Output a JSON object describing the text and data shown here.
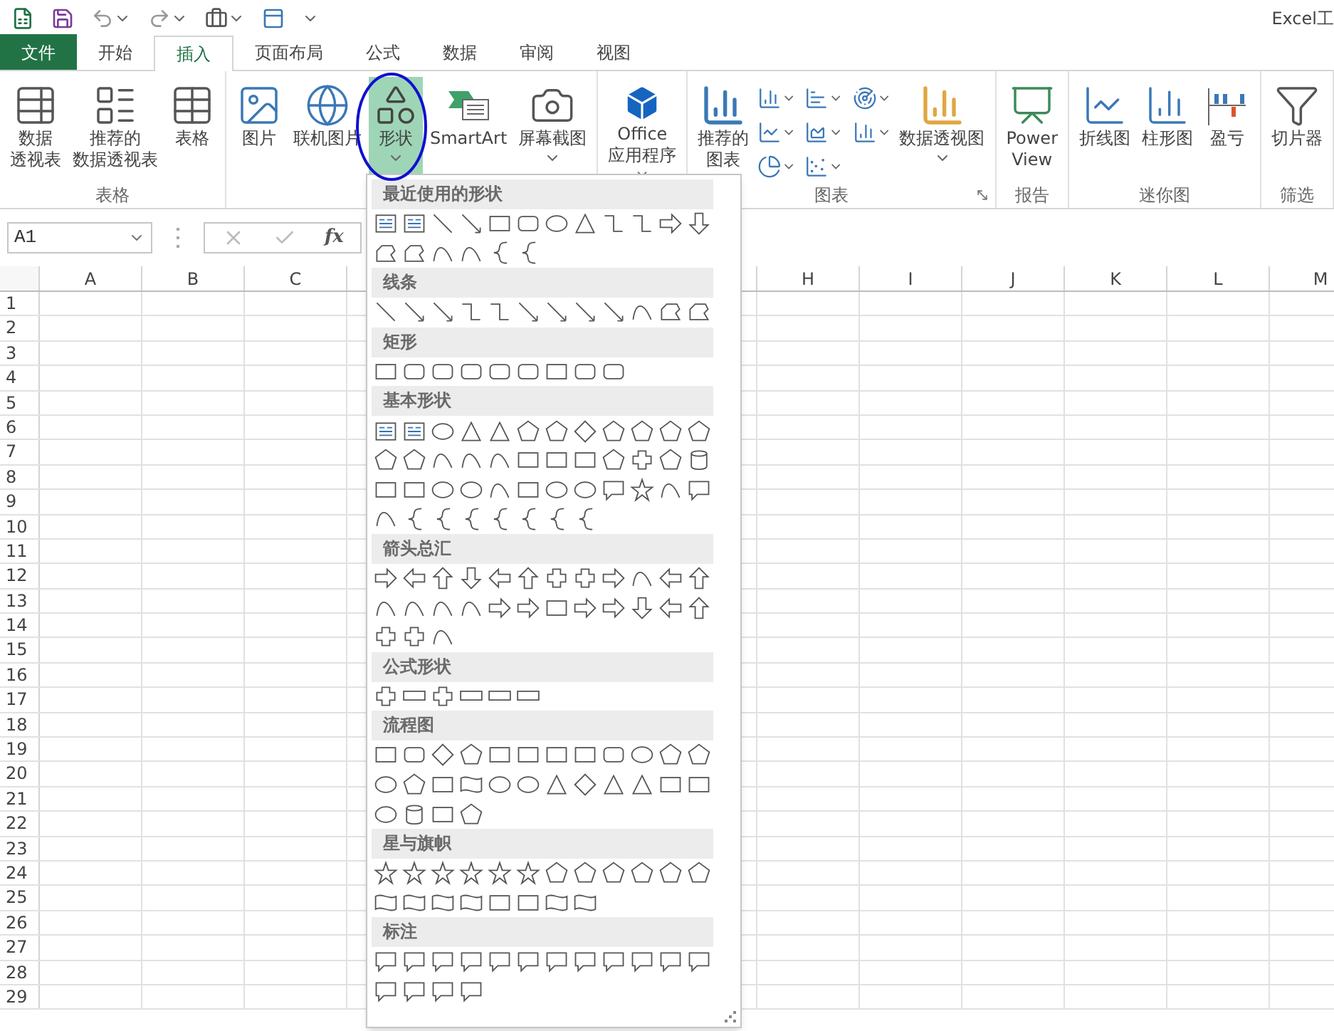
{
  "title_bar": {
    "title": "Excel工"
  },
  "tabs": [
    {
      "label": "文件",
      "kind": "file",
      "selected": false
    },
    {
      "label": "开始",
      "kind": "tab",
      "selected": false
    },
    {
      "label": "插入",
      "kind": "tab",
      "selected": true
    },
    {
      "label": "页面布局",
      "kind": "tab",
      "selected": false
    },
    {
      "label": "公式",
      "kind": "tab",
      "selected": false
    },
    {
      "label": "数据",
      "kind": "tab",
      "selected": false
    },
    {
      "label": "审阅",
      "kind": "tab",
      "selected": false
    },
    {
      "label": "视图",
      "kind": "tab",
      "selected": false
    }
  ],
  "ribbon": {
    "groups": [
      {
        "label": "表格",
        "items": [
          {
            "kind": "button",
            "lines": [
              "数据",
              "透视表"
            ],
            "dropdown": false,
            "selected": false
          },
          {
            "kind": "button",
            "lines": [
              "推荐的",
              "数据透视表"
            ],
            "dropdown": false,
            "selected": false
          },
          {
            "kind": "button",
            "lines": [
              "表格"
            ],
            "dropdown": false,
            "selected": false
          }
        ]
      },
      {
        "items": [
          {
            "kind": "button",
            "lines": [
              "图片"
            ],
            "dropdown": false,
            "selected": false
          },
          {
            "kind": "button",
            "lines": [
              "联机图片"
            ],
            "dropdown": false,
            "selected": false
          },
          {
            "kind": "button",
            "lines": [
              "形状"
            ],
            "dropdown": true,
            "selected": true
          },
          {
            "kind": "button",
            "lines": [
              "SmartArt"
            ],
            "dropdown": false,
            "selected": false
          },
          {
            "kind": "button",
            "lines": [
              "屏幕截图"
            ],
            "dropdown": true,
            "selected": false
          }
        ]
      },
      {
        "items": [
          {
            "kind": "button",
            "lines": [
              "Office",
              "应用程序"
            ],
            "dropdown": true,
            "selected": false
          }
        ]
      },
      {
        "label": "图表",
        "launcher": true,
        "items": [
          {
            "kind": "button",
            "lines": [
              "推荐的",
              "图表"
            ],
            "dropdown": false,
            "selected": false
          },
          {
            "kind": "gallery"
          },
          {
            "kind": "button",
            "lines": [
              "数据透视图"
            ],
            "dropdown": true,
            "selected": false
          }
        ]
      },
      {
        "label": "报告",
        "items": [
          {
            "kind": "button",
            "lines": [
              "Power",
              "View"
            ],
            "dropdown": false,
            "selected": false
          }
        ]
      },
      {
        "label": "迷你图",
        "items": [
          {
            "kind": "button",
            "lines": [
              "折线图"
            ],
            "dropdown": false,
            "selected": false
          },
          {
            "kind": "button",
            "lines": [
              "柱形图"
            ],
            "dropdown": false,
            "selected": false
          },
          {
            "kind": "button",
            "lines": [
              "盈亏"
            ],
            "dropdown": false,
            "selected": false
          }
        ]
      },
      {
        "label": "筛选",
        "items": [
          {
            "kind": "button",
            "lines": [
              "切片器"
            ],
            "dropdown": false,
            "selected": false
          }
        ]
      }
    ]
  },
  "formula_bar": {
    "name_box": "A1",
    "fx": "fx"
  },
  "sheet": {
    "columns": [
      "A",
      "B",
      "C",
      "H",
      "I",
      "J",
      "K",
      "L",
      "M"
    ],
    "rows": [
      "1",
      "2",
      "3",
      "4",
      "5",
      "6",
      "7",
      "8",
      "9",
      "10",
      "11",
      "12",
      "13",
      "14",
      "15",
      "16",
      "17",
      "18",
      "19",
      "20",
      "21",
      "22",
      "23",
      "24",
      "25",
      "26",
      "27",
      "28",
      "29"
    ]
  },
  "shapes_menu": {
    "sections": [
      {
        "title": "最近使用的形状"
      },
      {
        "title": "线条"
      },
      {
        "title": "矩形"
      },
      {
        "title": "基本形状"
      },
      {
        "title": "箭头总汇"
      },
      {
        "title": "公式形状"
      },
      {
        "title": "流程图"
      },
      {
        "title": "星与旗帜"
      },
      {
        "title": "标注"
      }
    ]
  }
}
